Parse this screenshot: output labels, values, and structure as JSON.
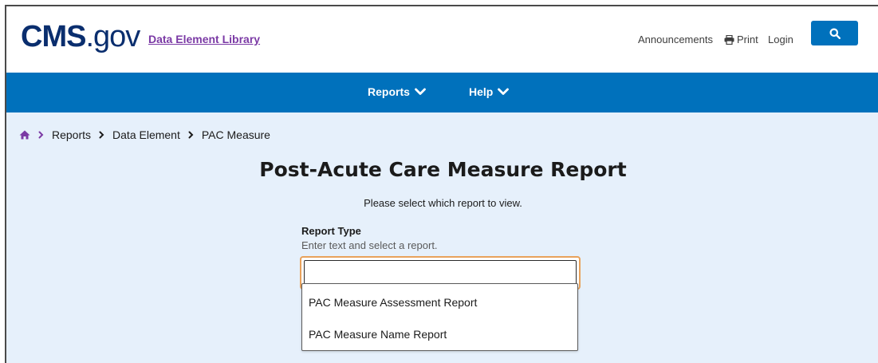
{
  "header": {
    "logo_bold": "CMS",
    "logo_rest": ".gov",
    "library_link": "Data Element Library",
    "announcements": "Announcements",
    "print": "Print",
    "login": "Login",
    "search_icon": "search-icon"
  },
  "nav": {
    "items": [
      {
        "label": "Reports",
        "icon": "chevron-down-icon"
      },
      {
        "label": "Help",
        "icon": "chevron-down-icon"
      }
    ]
  },
  "breadcrumb": {
    "home_icon": "home-icon",
    "items": [
      "Reports",
      "Data Element",
      "PAC Measure"
    ]
  },
  "main": {
    "title": "Post-Acute Care Measure Report",
    "subtitle": "Please select which report to view.",
    "field_label": "Report Type",
    "field_hint": "Enter text and select a report.",
    "input_value": "",
    "options": [
      "PAC Measure Assessment Report",
      "PAC Measure Name Report"
    ]
  },
  "colors": {
    "brand_blue": "#0071bc",
    "logo_navy": "#0a2e6e",
    "link_purple": "#7b3aa5",
    "focus_orange": "#e8a25c",
    "page_bg": "#e6f0fb"
  }
}
